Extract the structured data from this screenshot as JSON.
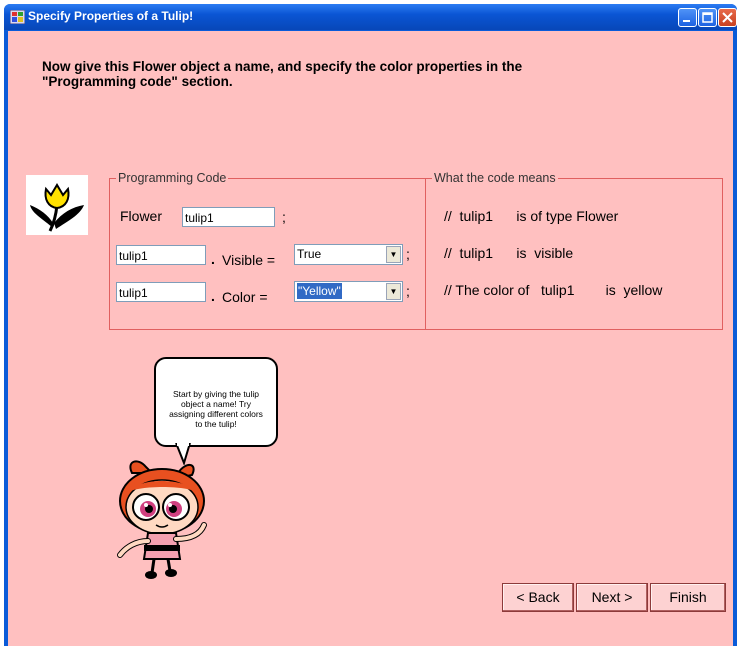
{
  "window": {
    "title": "Specify Properties of a Tulip!"
  },
  "instruction": {
    "line1": "Now give this Flower object a name, and specify the color properties in the",
    "line2": "\"Programming code\" section."
  },
  "image": {
    "icon": "tulip-flower-icon"
  },
  "programming_code": {
    "legend": "Programming Code",
    "flower_label": "Flower",
    "flower_name_value": "tulip1",
    "semicolon": ";",
    "visible_object_value": "tulip1",
    "dot": ".",
    "visible_label": "Visible =",
    "visible_value": "True",
    "color_object_value": "tulip1",
    "color_label": "Color  =",
    "color_value": "\"Yellow\""
  },
  "meaning": {
    "legend": "What the code means",
    "row1": "//  tulip1      is of type Flower",
    "row2": "//  tulip1      is  visible",
    "row3": "// The color of   tulip1        is  yellow"
  },
  "speech_bubble": {
    "lines": [
      "Start by giving the tulip",
      "object a name! Try",
      "assigning different colors",
      "to the tulip!"
    ]
  },
  "buttons": {
    "back": "< Back",
    "next": "Next >",
    "finish": "Finish"
  }
}
